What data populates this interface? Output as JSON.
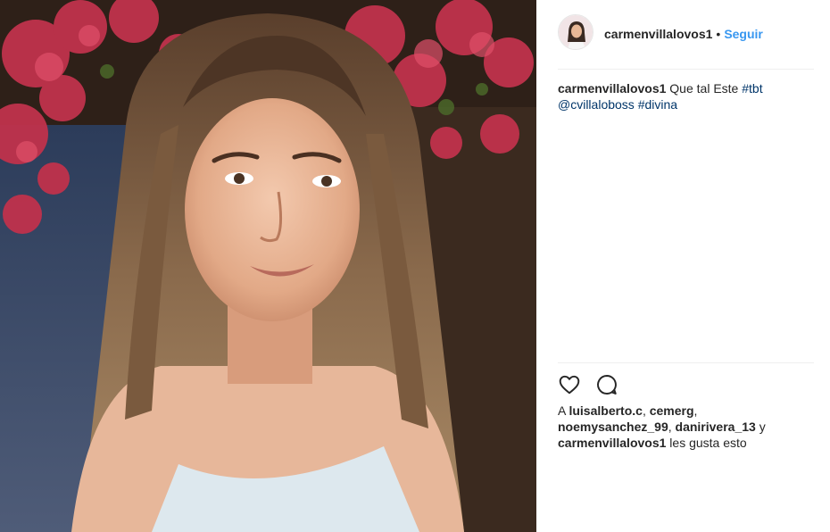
{
  "post": {
    "username": "carmenvillalovos1",
    "separator": "•",
    "follow_label": "Seguir",
    "photo_alt": "Photo posted by carmenvillalovos1"
  },
  "caption": {
    "username": "carmenvillalovos1",
    "text": "Que tal Este",
    "hashtag_1": "#tbt",
    "mention": "@cvillaloboss",
    "hashtag_2": "#divina"
  },
  "actions": {
    "like_icon": "heart-icon",
    "comment_icon": "comment-icon"
  },
  "likes": {
    "prefix": "A",
    "user_1": "luisalberto.c",
    "user_2": "cemerg",
    "user_3": "noemysanchez_99",
    "user_4": "danirivera_13",
    "joiner": "y",
    "user_5": "carmenvillalovos1",
    "suffix": "les gusta esto"
  }
}
